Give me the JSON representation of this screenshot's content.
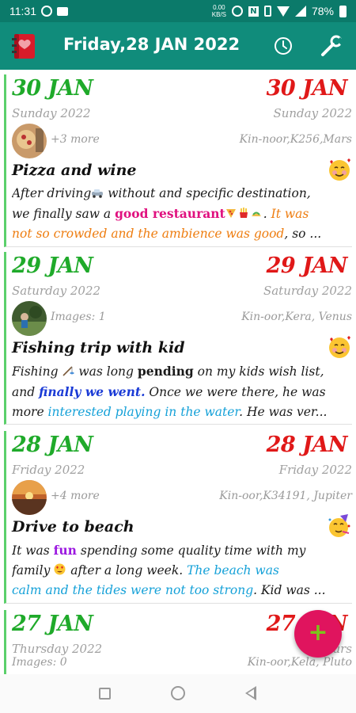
{
  "status_bar": {
    "time": "11:31",
    "net_speed_value": "0.00",
    "net_speed_unit": "KB/S",
    "battery": "78%"
  },
  "app_bar": {
    "title": "Friday,28 JAN 2022",
    "logo_icon": "diary-book-icon",
    "history_icon": "clock-icon",
    "settings_icon": "wrench-icon",
    "color": "#108c7b"
  },
  "entries": [
    {
      "date": "30 JAN",
      "day_year": "Sunday 2022",
      "media": "+3 more",
      "location": "Kin-noor,K256,Mars",
      "title": "Pizza and wine",
      "mood": "smiling-face-with-hearts",
      "text": {
        "l1a": "After driving",
        "l1b": " without and specific destination,",
        "l2a": "we finally saw a ",
        "l2b": "good restaurant",
        "l2c": ". ",
        "l2d": "It was",
        "l3a": "not so crowded and the ambience was good",
        "l3b": ", so ..."
      }
    },
    {
      "date": "29 JAN",
      "day_year": "Saturday 2022",
      "media": "Images: 1",
      "location": "Kin-oor,Kera, Venus",
      "title": "Fishing trip with kid",
      "mood": "smiling-face-with-hearts",
      "text": {
        "l1a": "Fishing ",
        "l1b": " was long ",
        "l1c": "pending",
        "l1d": " on my kids wish list,",
        "l2a": "and ",
        "l2b": "finally we went.",
        "l2c": " Once we were there, he was",
        "l3a": "more ",
        "l3b": "interested playing in the water",
        "l3c": ". He was ver..."
      }
    },
    {
      "date": "28 JAN",
      "day_year": "Friday 2022",
      "media": "+4 more",
      "location": "Kin-oor,K34191, Jupiter",
      "title": "Drive to beach",
      "mood": "partying-face",
      "text": {
        "l1a": "It was ",
        "l1b": "fun",
        "l1c": " spending some quality time with my",
        "l2a": "family ",
        "l2b": " after a long week. ",
        "l2c": "The beach was",
        "l3a": "calm and the tides were not too strong",
        "l3b": ". Kid was ..."
      }
    },
    {
      "date": "27 JAN",
      "date_right": "27 JAN",
      "day_year": "Thursday 2022",
      "day_year_right": "Thurs",
      "media": "Images: 0",
      "location": "Kin-oor,Kela, Pluto"
    }
  ],
  "fab": {
    "label": "+",
    "color": "#e0145e"
  },
  "colors": {
    "date_left": "#1faa2a",
    "date_right": "#e01818",
    "card_border": "#5bd06b"
  }
}
